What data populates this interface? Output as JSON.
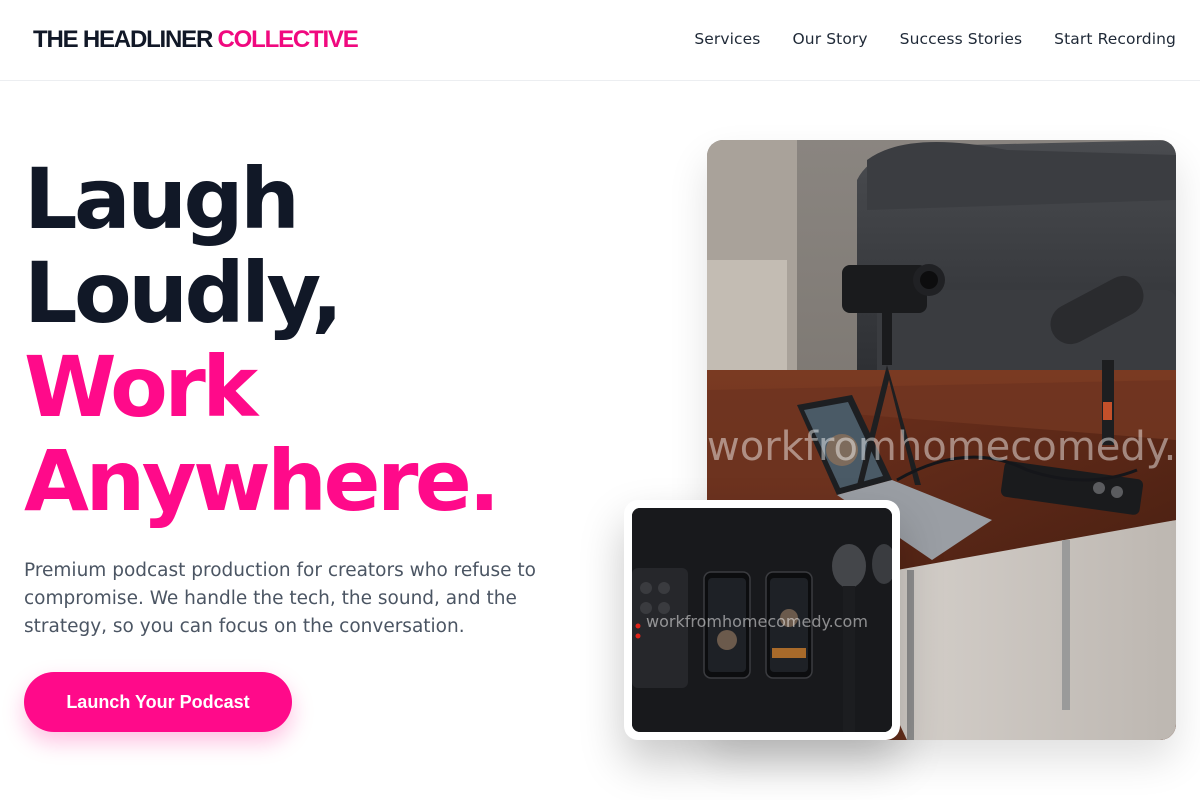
{
  "brand": {
    "name_primary": "THE HEADLINER",
    "name_accent": "COLLECTIVE"
  },
  "nav": {
    "items": [
      {
        "label": "Services"
      },
      {
        "label": "Our Story"
      },
      {
        "label": "Success Stories"
      },
      {
        "label": "Start Recording"
      }
    ]
  },
  "hero": {
    "headline_lines": [
      "Laugh",
      "Loudly,",
      "Work",
      "Anywhere."
    ],
    "subtitle": "Premium podcast production for creators who refuse to compromise. We handle the tech, the sound, and the strategy, so you can focus on the conversation.",
    "cta_label": "Launch Your Podcast"
  },
  "images": {
    "main_watermark": "workfromhomecomedy.com",
    "inset_watermark": "workfromhomecomedy.com"
  },
  "colors": {
    "accent": "#ff0a8a",
    "dark": "#111827",
    "muted": "#4b5563"
  }
}
